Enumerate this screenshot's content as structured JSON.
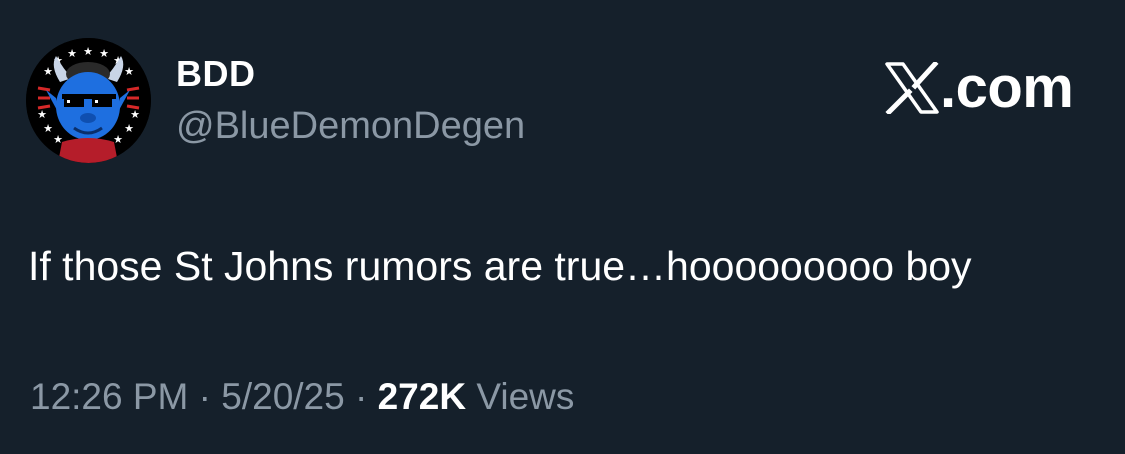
{
  "colors": {
    "background": "#15202b",
    "primary_text": "#ffffff",
    "secondary_text": "#8b98a5",
    "avatar_blue": "#1e6fe0"
  },
  "author": {
    "display_name": "BDD",
    "handle": "@BlueDemonDegen",
    "avatar_icon": "blue-demon-avatar-icon"
  },
  "brand": {
    "logo_icon": "x-logo-icon",
    "text": ".com"
  },
  "tweet": {
    "text": "If those St Johns rumors are true…hooooooooo boy"
  },
  "meta": {
    "time": "12:26 PM",
    "separator": " · ",
    "date": "5/20/25",
    "views_count": "272K",
    "views_label": "Views"
  }
}
